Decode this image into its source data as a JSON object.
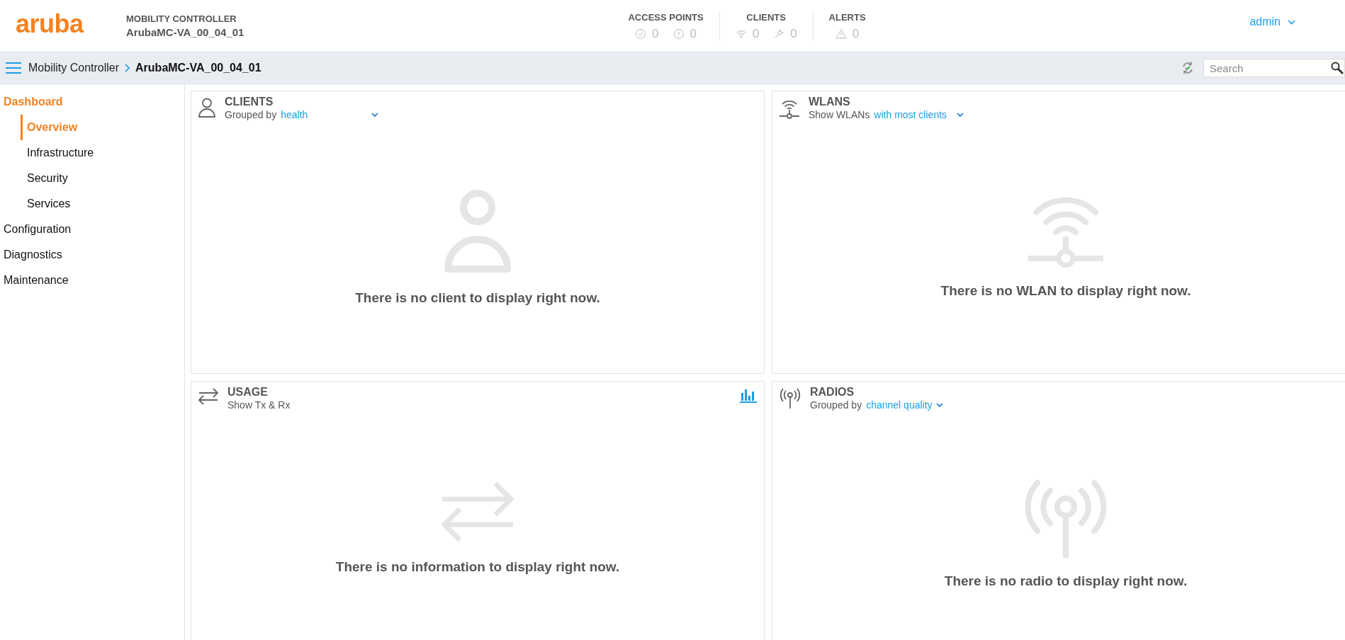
{
  "header": {
    "logo": "aruba",
    "product_label": "MOBILITY CONTROLLER",
    "device_name": "ArubaMC-VA_00_04_01",
    "stats": [
      {
        "title": "ACCESS POINTS",
        "counts": [
          {
            "kind": "up",
            "value": "0"
          },
          {
            "kind": "down",
            "value": "0"
          }
        ]
      },
      {
        "title": "CLIENTS",
        "counts": [
          {
            "kind": "wireless",
            "value": "0"
          },
          {
            "kind": "wired",
            "value": "0"
          }
        ]
      },
      {
        "title": "ALERTS",
        "counts": [
          {
            "kind": "alert",
            "value": "0"
          }
        ]
      }
    ],
    "user": "admin"
  },
  "breadcrumb": {
    "items": [
      {
        "label": "Mobility Controller",
        "current": false
      },
      {
        "label": "ArubaMC-VA_00_04_01",
        "current": true
      }
    ],
    "search": {
      "placeholder": "Search"
    }
  },
  "sidebar": {
    "items": [
      {
        "label": "Dashboard",
        "selected": true,
        "children": [
          {
            "label": "Overview",
            "selected": true
          },
          {
            "label": "Infrastructure",
            "selected": false
          },
          {
            "label": "Security",
            "selected": false
          },
          {
            "label": "Services",
            "selected": false
          }
        ]
      },
      {
        "label": "Configuration",
        "selected": false
      },
      {
        "label": "Diagnostics",
        "selected": false
      },
      {
        "label": "Maintenance",
        "selected": false
      }
    ]
  },
  "panels": [
    {
      "kind": "clients",
      "title": "CLIENTS",
      "subtitle": "Grouped by",
      "filter": "health",
      "empty_message": "There is no client to display right now."
    },
    {
      "kind": "wlans",
      "title": "WLANS",
      "subtitle": "Show WLANs",
      "filter": "with most clients",
      "empty_message": "There is no WLAN to display right now."
    },
    {
      "kind": "usage",
      "title": "USAGE",
      "subtitle": "Show Tx & Rx",
      "empty_message": "There is no information to display right now."
    },
    {
      "kind": "radios",
      "title": "RADIOS",
      "subtitle": "Grouped by",
      "filter": "channel quality",
      "empty_message": "There is no radio to display right now."
    }
  ]
}
